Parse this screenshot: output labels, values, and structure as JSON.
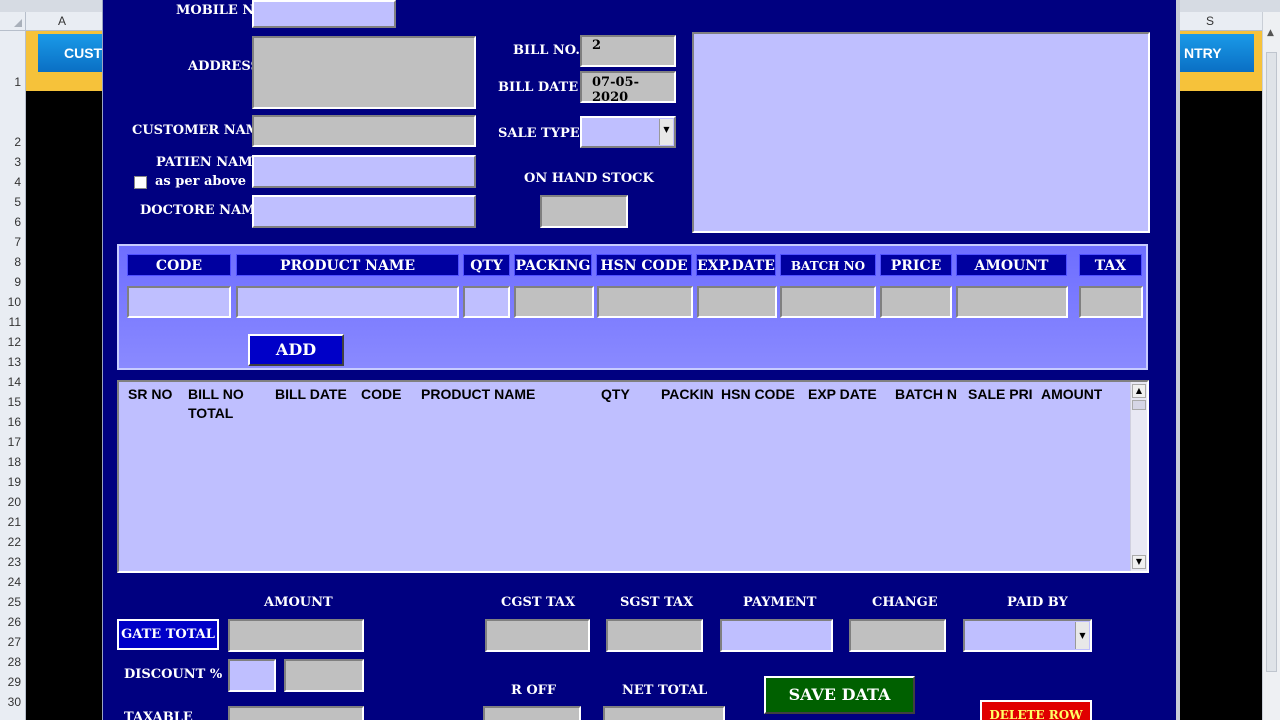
{
  "excel": {
    "col_headers": [
      "A",
      "S"
    ],
    "row_numbers": [
      "1",
      "2",
      "3",
      "4",
      "5",
      "6",
      "7",
      "8",
      "9",
      "10",
      "11",
      "12",
      "13",
      "14",
      "15",
      "16",
      "17",
      "18",
      "19",
      "20",
      "21",
      "22",
      "23",
      "24",
      "25",
      "26",
      "27",
      "28",
      "29",
      "30"
    ],
    "left_button_text": "CUST",
    "right_button_text": "NTRY",
    "colors": {
      "sheet_header": "#e9edf3",
      "yellow_fill": "#f6c23a",
      "sheet_button": "#0a6fc4"
    }
  },
  "form": {
    "colors": {
      "background": "#000080",
      "input_gray": "#c0c0c0",
      "input_lavender": "#bfbfff",
      "accent_blue": "#0000c8",
      "save_green": "#006000",
      "delete_red": "#e00000"
    },
    "customer": {
      "mobile_label": "MOBILE NO",
      "address_label": "ADDRESS",
      "customer_name_label": "CUSTOMER NAME",
      "patient_name_label": "PATIEN NAME",
      "as_per_above_label": "as per above",
      "doctor_name_label": "DOCTORE NAME"
    },
    "bill": {
      "bill_no_label": "BILL NO.",
      "bill_no_value": "2",
      "bill_date_label": "BILL DATE",
      "bill_date_value": "07-05-2020",
      "sale_type_label": "SALE TYPE",
      "on_hand_stock_label": "ON HAND STOCK"
    },
    "entry": {
      "headers": [
        "CODE",
        "PRODUCT NAME",
        "QTY",
        "PACKING",
        "HSN CODE",
        "EXP.DATE",
        "BATCH NO",
        "PRICE",
        "AMOUNT",
        "TAX"
      ],
      "add_label": "ADD"
    },
    "list": {
      "headers": [
        "SR NO",
        "BILL NO",
        "BILL DATE",
        "CODE",
        "PRODUCT NAME",
        "QTY",
        "PACKIN",
        "HSN CODE",
        "EXP DATE",
        "BATCH N",
        "SALE PRI",
        "AMOUNT"
      ],
      "second_line": "TOTAL"
    },
    "totals": {
      "amount_label": "AMOUNT",
      "gate_total_label": "GATE TOTAL",
      "discount_label": "DISCOUNT %",
      "taxable_label": "TAXABLE",
      "cgst_label": "CGST TAX",
      "sgst_label": "SGST TAX",
      "payment_label": "PAYMENT",
      "change_label": "CHANGE",
      "paid_by_label": "PAID BY",
      "roff_label": "R OFF",
      "net_total_label": "NET TOTAL",
      "save_label": "SAVE DATA",
      "delete_label": "DELETE ROW"
    }
  }
}
